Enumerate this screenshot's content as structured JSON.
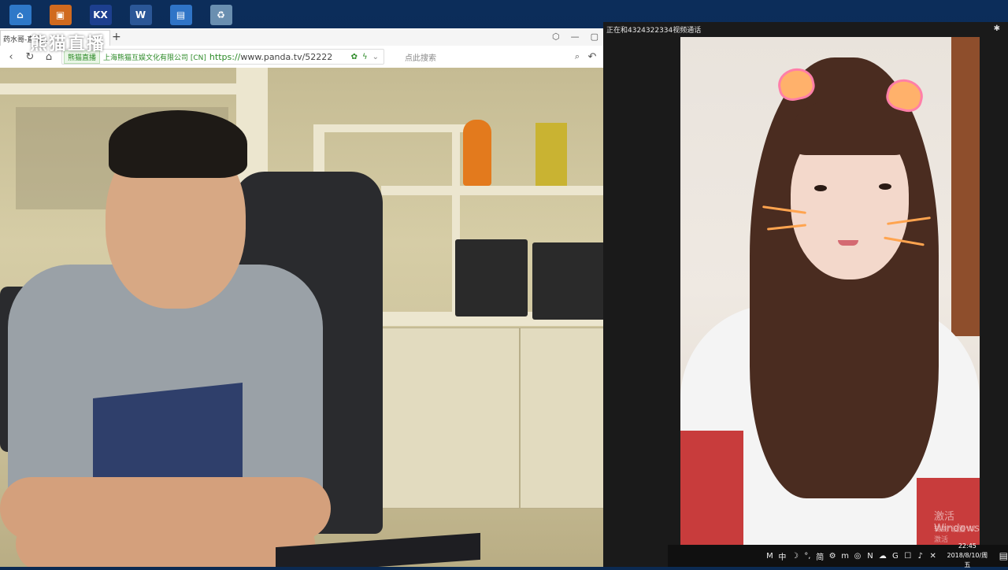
{
  "desktop_icons": [
    {
      "name": "computer-icon",
      "color": "#2e78c8",
      "glyph": "⌂"
    },
    {
      "name": "game-icon",
      "color": "#d06a1f",
      "glyph": "▣"
    },
    {
      "name": "kx-icon",
      "color": "#1d3f8f",
      "glyph": "KX"
    },
    {
      "name": "word-icon",
      "color": "#2b5797",
      "glyph": "W"
    },
    {
      "name": "document-icon",
      "color": "#2f74c7",
      "glyph": "▤"
    },
    {
      "name": "recycle-bin-icon",
      "color": "#6a8fb0",
      "glyph": "♻"
    }
  ],
  "browser": {
    "tab_title": "药水哥-直播...",
    "new_tab": "+",
    "window_controls": [
      "⬡",
      "—",
      "▢"
    ],
    "back": "‹",
    "refresh": "↻",
    "home": "⌂",
    "cert_label": "熊猫直播",
    "cert_company": "上海熊猫互娱文化有限公司 [CN]",
    "url_https": "https://",
    "url_rest": "www.panda.tv/52222",
    "search_placeholder": "点此搜索",
    "search_icon": "⌕",
    "undo_icon": "↶"
  },
  "logo": {
    "text": "熊猫直播"
  },
  "call": {
    "title": "正在和4324322334视频通话",
    "pin": "✱"
  },
  "activation": {
    "line1": "激活 Windows",
    "line2": "转到\"设置\"以激活 Windows。"
  },
  "tray": {
    "items": [
      "M",
      "中",
      "☽",
      "°,",
      "简",
      "⚙"
    ],
    "apps": [
      "m",
      "◎",
      "N",
      "☁",
      "G",
      "☐",
      "♪",
      "✕"
    ],
    "time": "22:45",
    "date": "2018/8/10/周五",
    "notification": "▤"
  }
}
